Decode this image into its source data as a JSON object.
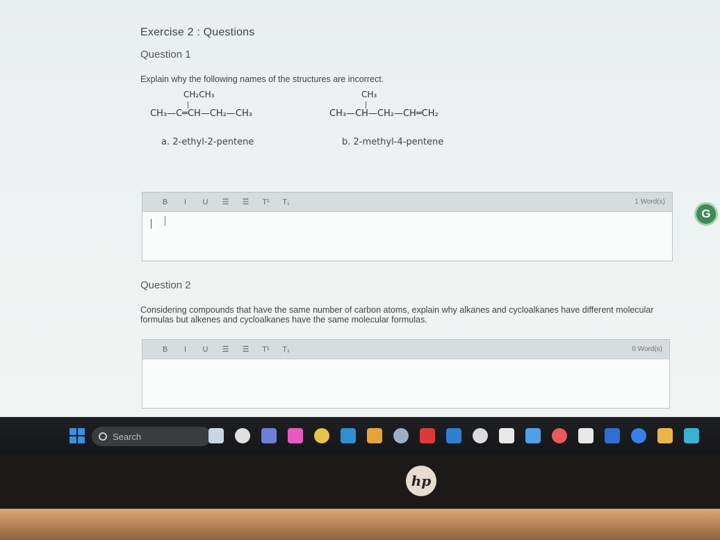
{
  "page": {
    "title": "Exercise 2 : Questions"
  },
  "question1": {
    "title": "Question 1",
    "prompt": "Explain why the following names of the structures are incorrect.",
    "structure_a": {
      "branch": "CH₂CH₃",
      "formula": "CH₃—C═CH—CH₂—CH₃",
      "caption": "a. 2-ethyl-2-pentene"
    },
    "structure_b": {
      "branch": "CH₃",
      "formula": "CH₃—CH—CH₂—CH═CH₂",
      "caption": "b. 2-methyl-4-pentene"
    },
    "editor": {
      "toolbar": [
        "B",
        "I",
        "U",
        "☰",
        "☰",
        "T¹",
        "T₁"
      ],
      "word_count": "1 Word(s)"
    }
  },
  "question2": {
    "title": "Question 2",
    "prompt": "Considering compounds that have the same number of carbon atoms, explain why alkanes and cycloalkanes have different molecular formulas but alkenes and cycloalkanes have the same molecular formulas.",
    "editor": {
      "toolbar": [
        "B",
        "I",
        "U",
        "☰",
        "☰",
        "T¹",
        "T₁"
      ],
      "word_count": "0 Word(s)"
    }
  },
  "taskbar": {
    "search_label": "Search",
    "icon_colors": [
      "#c9d6e6",
      "#e0e0e0",
      "#6f7fd9",
      "#e85ac0",
      "#e8c24a",
      "#2f8fd3",
      "#e8a23a",
      "#9ab0c8",
      "#d93a3a",
      "#2f7fd3",
      "#dcdcdc",
      "#e8e8e8",
      "#4f9fe8",
      "#e85a5a",
      "#e8e8e8",
      "#2f6fd3",
      "#3a7fe8",
      "#e8b64a",
      "#3ab0d3"
    ]
  },
  "laptop": {
    "brand": "hp"
  }
}
